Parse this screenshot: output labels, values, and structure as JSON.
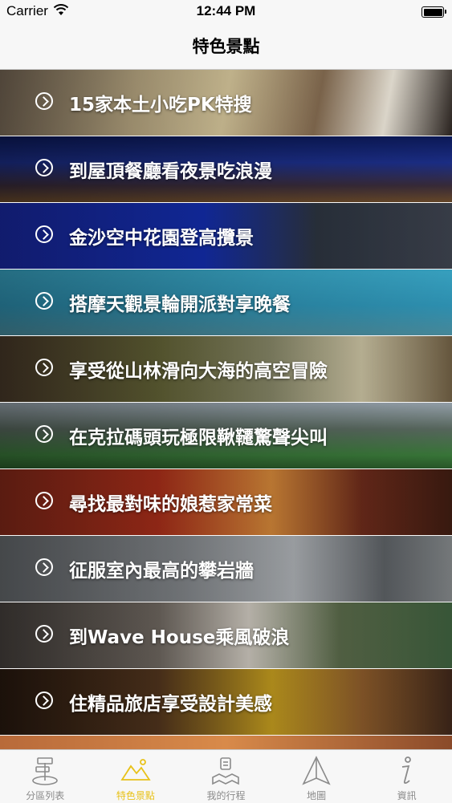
{
  "status_bar": {
    "carrier": "Carrier",
    "time": "12:44 PM"
  },
  "nav": {
    "title": "特色景點"
  },
  "items": [
    {
      "label": "15家本土小吃PK特搜"
    },
    {
      "label": "到屋頂餐廳看夜景吃浪漫"
    },
    {
      "label": "金沙空中花園登高攬景"
    },
    {
      "label": "搭摩天觀景輪開派對享晚餐"
    },
    {
      "label": "享受從山林滑向大海的高空冒險"
    },
    {
      "label": "在克拉碼頭玩極限鞦韆驚聲尖叫"
    },
    {
      "label": "尋找最對味的娘惹家常菜"
    },
    {
      "label": "征服室內最高的攀岩牆"
    },
    {
      "label": "到Wave House乘風破浪"
    },
    {
      "label": "住精品旅店享受設計美感"
    }
  ],
  "tabs": [
    {
      "label": "分區列表",
      "icon": "signpost-icon",
      "active": false
    },
    {
      "label": "特色景點",
      "icon": "mountain-icon",
      "active": true
    },
    {
      "label": "我的行程",
      "icon": "itinerary-map-icon",
      "active": false
    },
    {
      "label": "地圖",
      "icon": "navigation-arrow-icon",
      "active": false
    },
    {
      "label": "資訊",
      "icon": "info-icon",
      "active": false
    }
  ],
  "colors": {
    "accent": "#e8c21a",
    "inactive": "#8a8a8a"
  }
}
